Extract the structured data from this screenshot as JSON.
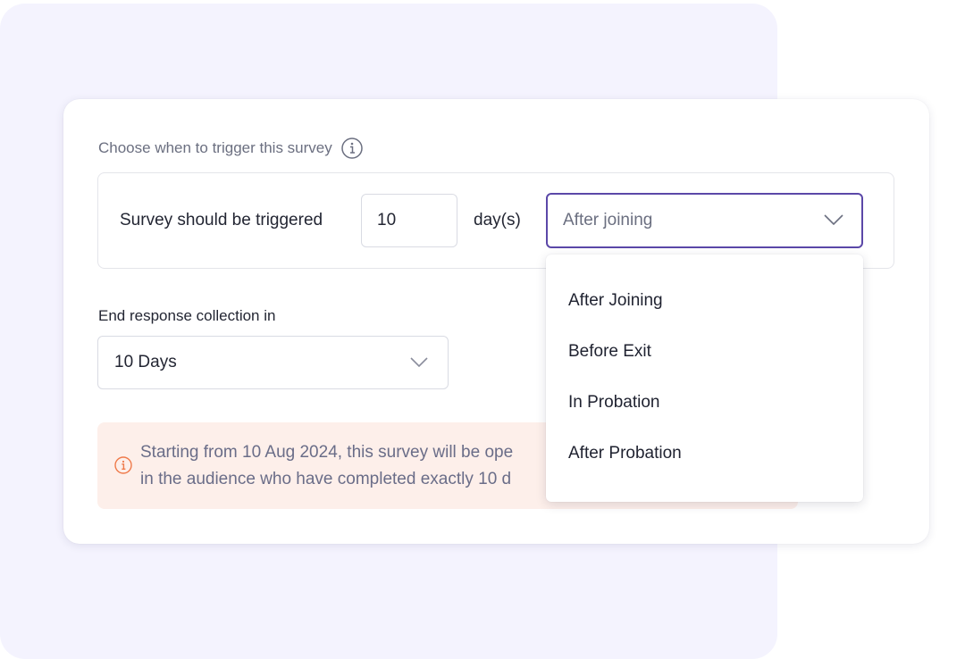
{
  "trigger_section": {
    "label": "Choose when to trigger this survey",
    "info_icon": "info-icon",
    "sentence_label": "Survey should be triggered",
    "days_value": "10",
    "days_unit": "day(s)",
    "timing_selected": "After joining"
  },
  "end_collection": {
    "label": "End response collection in",
    "selected": "10 Days"
  },
  "notice": {
    "icon": "info-icon",
    "line1": "Starting from 10 Aug 2024, this survey will be ope",
    "line2": "in the audience who have completed exactly 10 d"
  },
  "timing_dropdown": {
    "options": [
      "After Joining",
      "Before Exit",
      "In Probation",
      "After Probation"
    ]
  },
  "colors": {
    "accent": "#5b48a8",
    "background_panel": "#f4f3fe",
    "notice_bg": "#fdefea",
    "notice_icon": "#ef7a4a"
  }
}
